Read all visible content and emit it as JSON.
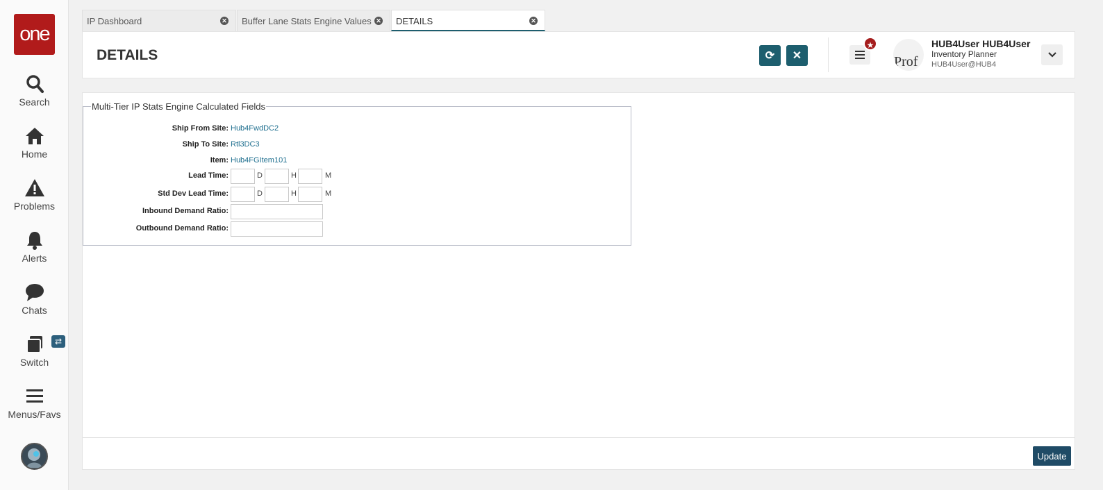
{
  "app": {
    "logo_text": "one"
  },
  "sidebar": {
    "items": [
      {
        "label": "Search",
        "icon": "search-icon"
      },
      {
        "label": "Home",
        "icon": "home-icon"
      },
      {
        "label": "Problems",
        "icon": "warning-icon"
      },
      {
        "label": "Alerts",
        "icon": "bell-icon"
      },
      {
        "label": "Chats",
        "icon": "chat-bubble-icon"
      },
      {
        "label": "Switch",
        "icon": "stack-icon"
      },
      {
        "label": "Menus/Favs",
        "icon": "hamburger-icon"
      }
    ],
    "switch_badge": "⇄"
  },
  "tabs": [
    {
      "label": "IP Dashboard",
      "active": false
    },
    {
      "label": "Buffer Lane Stats Engine Values",
      "active": false
    },
    {
      "label": "DETAILS",
      "active": true
    }
  ],
  "header": {
    "title": "DETAILS",
    "refresh_icon": "⟳",
    "close_icon": "✕",
    "user": {
      "name": "HUB4User HUB4User",
      "role": "Inventory Planner",
      "id": "HUB4User@HUB4",
      "avatar_text": "Prof"
    }
  },
  "form": {
    "legend": "Multi-Tier IP Stats Engine Calculated Fields",
    "ship_from_label": "Ship From Site:",
    "ship_from_value": "Hub4FwdDC2",
    "ship_to_label": "Ship To Site:",
    "ship_to_value": "Rtl3DC3",
    "item_label": "Item:",
    "item_value": "Hub4FGItem101",
    "lead_time_label": "Lead Time:",
    "std_dev_label": "Std Dev Lead Time:",
    "inbound_label": "Inbound Demand Ratio:",
    "outbound_label": "Outbound Demand Ratio:",
    "unit_d": "D",
    "unit_h": "H",
    "unit_m": "M",
    "lead_time": {
      "d": "",
      "h": "",
      "m": ""
    },
    "std_dev_lead_time": {
      "d": "",
      "h": "",
      "m": ""
    },
    "inbound_demand_ratio": "",
    "outbound_demand_ratio": ""
  },
  "footer": {
    "update_label": "Update"
  },
  "colors": {
    "brand": "#b11b1b",
    "accent": "#1d5e6e",
    "update": "#1f4b66",
    "link": "#1d6e8e"
  }
}
